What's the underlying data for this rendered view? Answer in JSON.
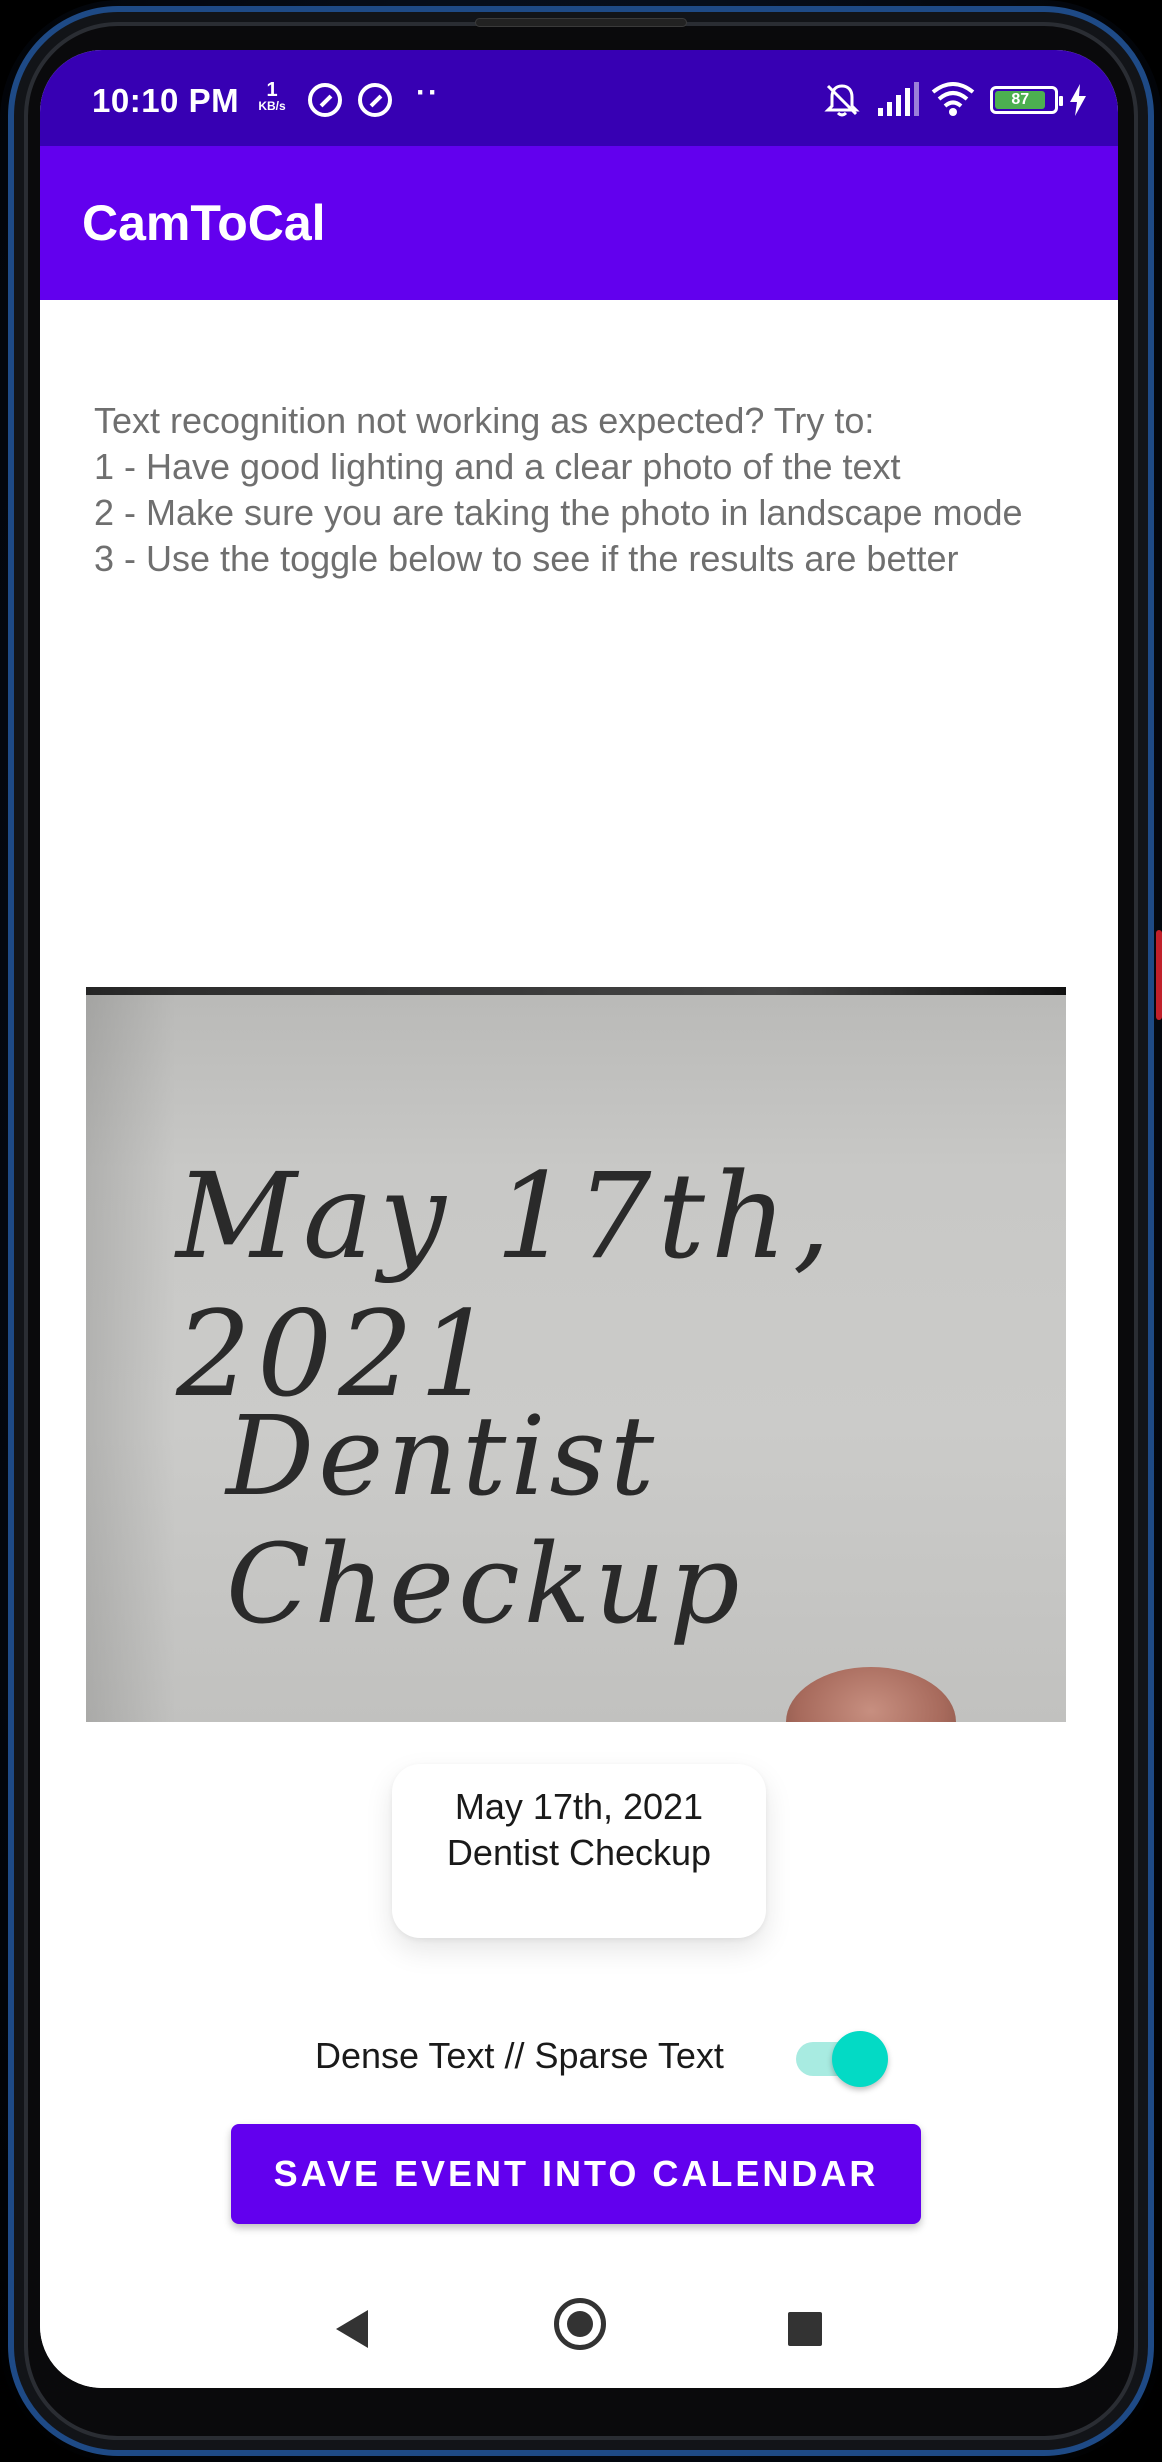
{
  "status_bar": {
    "time": "10:10 PM",
    "net_speed_value": "1",
    "net_speed_unit": "KB/s",
    "overflow_dots": "··",
    "battery_level": "87",
    "icons": [
      "mute-notifications-icon",
      "signal-icon",
      "wifi-icon",
      "battery-icon",
      "charging-bolt-icon"
    ]
  },
  "app_bar": {
    "title": "CamToCal"
  },
  "tips": {
    "heading": "Text recognition not working as expected? Try to:",
    "items": [
      "1 - Have good lighting and a clear photo of the text",
      "2 - Make sure you are taking the photo in landscape mode",
      "3 - Use the toggle below to see if the results are better"
    ]
  },
  "photo": {
    "handwritten_line_1": "May 17th, 2021",
    "handwritten_line_2": "Dentist Checkup"
  },
  "result": {
    "line_1": "May 17th, 2021",
    "line_2": "Dentist Checkup"
  },
  "toggle": {
    "label": "Dense Text // Sparse Text",
    "checked": true,
    "accent_color": "#03dac5"
  },
  "actions": {
    "save_label": "SAVE EVENT INTO CALENDAR"
  },
  "colors": {
    "primary": "#6200ee",
    "primary_dark": "#3700b3",
    "secondary": "#03dac5"
  }
}
